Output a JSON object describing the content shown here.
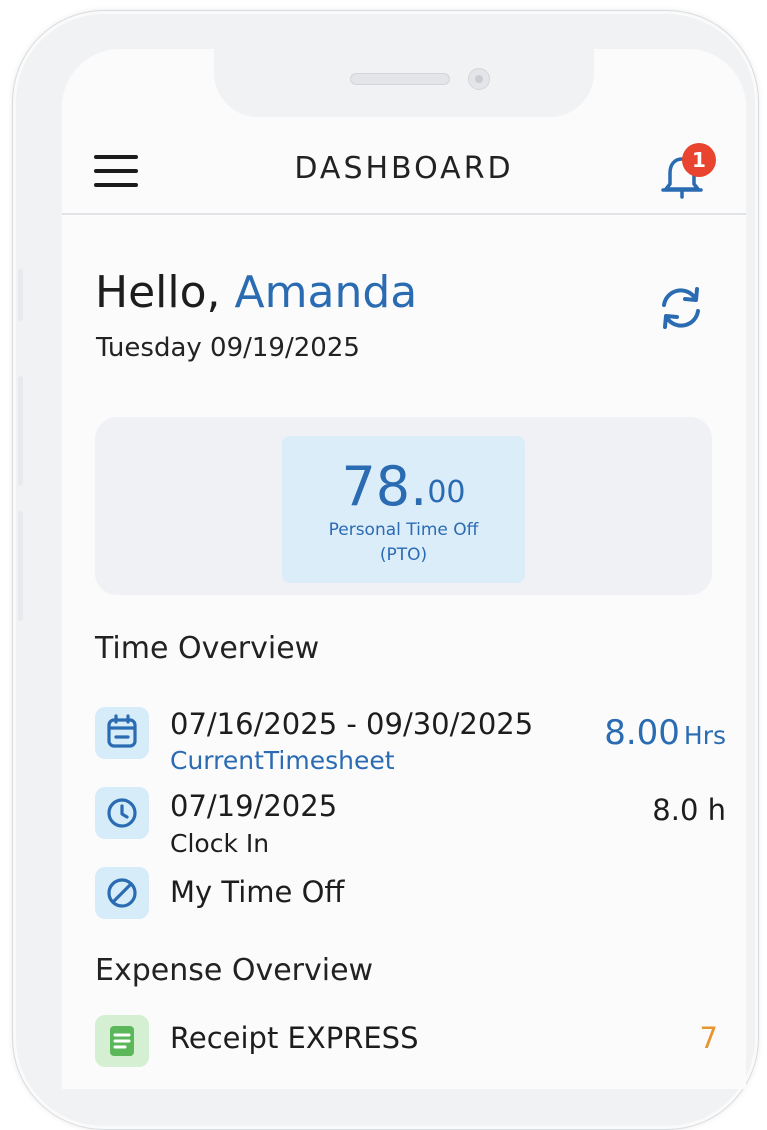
{
  "header": {
    "title": "DASHBOARD",
    "notification_count": "1"
  },
  "greeting": {
    "hello": "Hello,",
    "name": "Amanda",
    "date": "Tuesday 09/19/2025"
  },
  "pto": {
    "value_whole": "78.",
    "value_decimal": "00",
    "label_line1": "Personal Time Off",
    "label_line2": "(PTO)"
  },
  "time_overview": {
    "title": "Time Overview",
    "timesheet": {
      "range": "07/16/2025 - 09/30/2025",
      "label": "CurrentTimesheet",
      "hours": "8.00",
      "hours_unit": "Hrs",
      "icon": "calendar-icon"
    },
    "clock_in": {
      "date": "07/19/2025",
      "label": "Clock In",
      "hours": "8.0 h",
      "icon": "clock-icon"
    },
    "time_off": {
      "label": "My Time Off",
      "icon": "no-entry-icon"
    }
  },
  "expense_overview": {
    "title": "Expense Overview",
    "receipt_express": {
      "label": "Receipt EXPRESS",
      "count": "7",
      "icon": "receipt-icon"
    }
  },
  "colors": {
    "accent": "#2a6bb2",
    "badge": "#e8442f",
    "count": "#e6962f",
    "pto_box": "#dcedfa"
  }
}
